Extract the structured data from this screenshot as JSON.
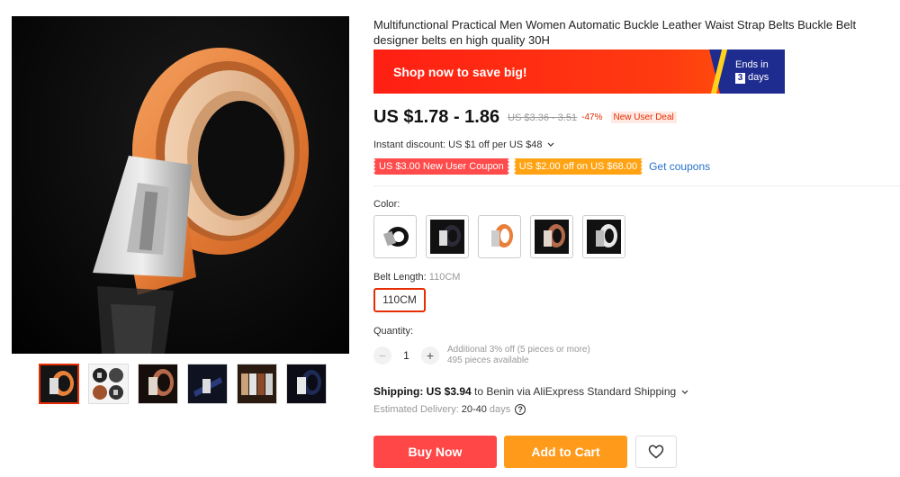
{
  "product": {
    "title": "Multifunctional Practical Men Women Automatic Buckle Leather Waist Strap Belts Buckle Belt designer belts en high quality 30H"
  },
  "promo": {
    "text": "Shop now to save big!",
    "ends_label": "Ends in",
    "days_number": "3",
    "days_label": "days",
    "colors": {
      "banner": "#ff2a12",
      "timer": "#1f2c8f"
    }
  },
  "pricing": {
    "price": "US $1.78 - 1.86",
    "old_price": "US $3.36 - 3.51",
    "discount": "-47%",
    "deal_badge": "New User Deal",
    "instant_discount": "Instant discount: US $1 off per US $48"
  },
  "coupons": {
    "items": [
      "US $3.00 New User Coupon",
      "US $2.00 off on US $68.00"
    ],
    "link": "Get coupons"
  },
  "options": {
    "color_label": "Color:",
    "length_label": "Belt Length:",
    "length_value": "110CM",
    "selected_length": "110CM"
  },
  "quantity": {
    "label": "Quantity:",
    "value": "1",
    "minus": "−",
    "plus": "+",
    "note_line1": "Additional 3% off (5 pieces or more)",
    "note_line2": "495 pieces available"
  },
  "shipping": {
    "prefix": "Shipping: US $3.94",
    "suffix": " to Benin via AliExpress Standard Shipping",
    "estimate_label": "Estimated Delivery:",
    "estimate_days": "20-40",
    "estimate_unit": "days"
  },
  "actions": {
    "buy_now": "Buy Now",
    "add_to_cart": "Add to Cart"
  },
  "colors": {
    "accent": "#e62e04",
    "buy_now": "#ff4747",
    "add_to_cart": "#ff9a1a",
    "link": "#2671c9"
  },
  "icons": {
    "chevron": "chevron-down-icon",
    "wishlist": "heart-icon",
    "help": "help-circle-icon"
  }
}
